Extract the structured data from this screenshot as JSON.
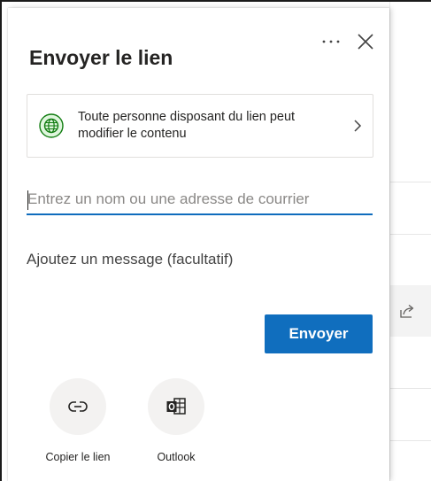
{
  "dialog": {
    "title": "Envoyer le lien",
    "more_icon": "more-options-icon",
    "close_icon": "close-icon"
  },
  "permission": {
    "icon": "globe-icon",
    "text": "Toute personne disposant du lien peut modifier le contenu",
    "chevron_icon": "chevron-right-icon"
  },
  "recipient": {
    "value": "",
    "placeholder": "Entrez un nom ou une adresse de courrier"
  },
  "message": {
    "value": "",
    "placeholder": "Ajoutez un message (facultatif)"
  },
  "send_button": {
    "label": "Envoyer"
  },
  "share_options": [
    {
      "label": "Copier le lien",
      "icon": "link-icon"
    },
    {
      "label": "Outlook",
      "icon": "outlook-icon"
    }
  ],
  "background": {
    "share_icon": "share-icon"
  },
  "colors": {
    "accent": "#106ebe",
    "input_underline": "#0f6cbd",
    "globe": "#107c10",
    "text": "#252423"
  }
}
